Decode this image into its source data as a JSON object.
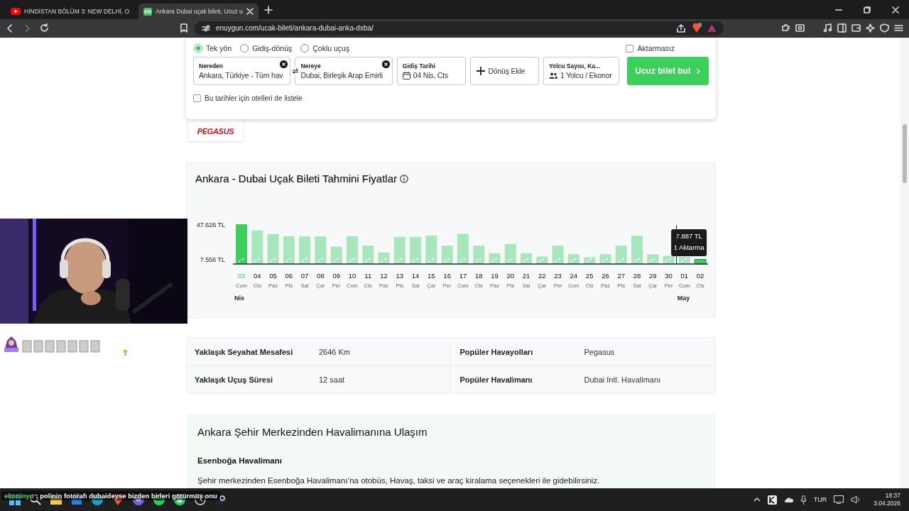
{
  "browser": {
    "tabs": [
      {
        "title": "HİNDİSTAN BÖLÜM 3: NEW DELHİ, O",
        "kind": "video",
        "selected": false
      },
      {
        "title": "Ankara Dubai uçak bileti, Ucuz u",
        "kind": "site",
        "favicon": "EN",
        "selected": true
      }
    ],
    "url": "enuygun.com/ucak-bileti/ankara-dubai-anka-dxba/"
  },
  "search_form": {
    "trip_types": [
      {
        "label": "Tek yön",
        "selected": true
      },
      {
        "label": "Gidiş-dönüş",
        "selected": false
      },
      {
        "label": "Çoklu uçuş",
        "selected": false
      }
    ],
    "nonstop": {
      "label": "Aktarmasız",
      "checked": false
    },
    "fields": [
      {
        "kind": "location",
        "label": "Nereden",
        "value": "Ankara, Türkiye - Tüm hav"
      },
      {
        "kind": "location",
        "label": "Nereye",
        "value": "Dubai, Birleşik Arap Emirli"
      },
      {
        "kind": "date",
        "label": "Gidiş Tarihi",
        "value": "04 Nis, Cts"
      },
      {
        "kind": "add",
        "value": "Dönüş Ekle"
      },
      {
        "kind": "passengers",
        "label": "Yolcu Sayısı, Ka...",
        "value": "1 Yolcu / Ekonor"
      }
    ],
    "search_button": "Ucuz bilet bul",
    "hotels": {
      "label": "Bu tarihler için otelleri de listele",
      "checked": false
    }
  },
  "airline_logo": "PEGASUS",
  "price_chart": {
    "title": "Ankara - Dubai Uçak Bileti Tahmini Fiyatlar",
    "chart_data": {
      "type": "bar",
      "categories": [
        "03",
        "04",
        "05",
        "06",
        "07",
        "08",
        "09",
        "10",
        "11",
        "12",
        "13",
        "14",
        "15",
        "16",
        "17",
        "18",
        "19",
        "20",
        "21",
        "22",
        "23",
        "24",
        "25",
        "26",
        "27",
        "28",
        "29",
        "30",
        "01",
        "02"
      ],
      "series": [
        {
          "color": "#a8e6bc",
          "values": [
            null,
            40700,
            36500,
            34100,
            33800,
            33800,
            22200,
            34100,
            23400,
            15600,
            33400,
            33400,
            34900,
            23400,
            36800,
            23400,
            14900,
            25300,
            14900,
            11000,
            23400,
            13700,
            10300,
            13700,
            23400,
            34500,
            13700,
            11800,
            10600,
            null
          ]
        },
        {
          "color": "#3ccf5c",
          "values": [
            47600,
            null,
            null,
            null,
            null,
            null,
            null,
            null,
            null,
            null,
            null,
            null,
            null,
            null,
            null,
            null,
            null,
            null,
            null,
            null,
            null,
            null,
            null,
            null,
            null,
            null,
            null,
            null,
            null,
            7887
          ]
        }
      ],
      "ylim": [
        2650,
        47626
      ],
      "yticks": [
        {
          "value": 47626,
          "label": "47.626 TL"
        },
        {
          "value": 7556,
          "label": "7.556 TL"
        }
      ]
    },
    "days": [
      {
        "weekday": "Cum",
        "selected": true,
        "hovered": false
      },
      {
        "weekday": "Cts",
        "selected": false,
        "hovered": false
      },
      {
        "weekday": "Paz",
        "selected": false,
        "hovered": false
      },
      {
        "weekday": "Pts",
        "selected": false,
        "hovered": false
      },
      {
        "weekday": "Sal",
        "selected": false,
        "hovered": false
      },
      {
        "weekday": "Çar",
        "selected": false,
        "hovered": false
      },
      {
        "weekday": "Per",
        "selected": false,
        "hovered": false
      },
      {
        "weekday": "Cum",
        "selected": false,
        "hovered": false
      },
      {
        "weekday": "Cts",
        "selected": false,
        "hovered": false
      },
      {
        "weekday": "Paz",
        "selected": false,
        "hovered": false
      },
      {
        "weekday": "Pts",
        "selected": false,
        "hovered": false
      },
      {
        "weekday": "Sal",
        "selected": false,
        "hovered": false
      },
      {
        "weekday": "Çar",
        "selected": false,
        "hovered": false
      },
      {
        "weekday": "Per",
        "selected": false,
        "hovered": false
      },
      {
        "weekday": "Cum",
        "selected": false,
        "hovered": false
      },
      {
        "weekday": "Cts",
        "selected": false,
        "hovered": false
      },
      {
        "weekday": "Paz",
        "selected": false,
        "hovered": false
      },
      {
        "weekday": "Pts",
        "selected": false,
        "hovered": false
      },
      {
        "weekday": "Sal",
        "selected": false,
        "hovered": false
      },
      {
        "weekday": "Çar",
        "selected": false,
        "hovered": false
      },
      {
        "weekday": "Per",
        "selected": false,
        "hovered": false
      },
      {
        "weekday": "Cum",
        "selected": false,
        "hovered": false
      },
      {
        "weekday": "Cts",
        "selected": false,
        "hovered": false
      },
      {
        "weekday": "Paz",
        "selected": false,
        "hovered": false
      },
      {
        "weekday": "Pts",
        "selected": false,
        "hovered": false
      },
      {
        "weekday": "Sal",
        "selected": false,
        "hovered": false
      },
      {
        "weekday": "Çar",
        "selected": false,
        "hovered": false
      },
      {
        "weekday": "Per",
        "selected": false,
        "hovered": false
      },
      {
        "weekday": "Cum",
        "selected": false,
        "hovered": false
      },
      {
        "weekday": "Cts",
        "selected": false,
        "hovered": true
      }
    ],
    "months": [
      {
        "label": "Nis",
        "month_start": false
      },
      {
        "label": "May",
        "month_start": true
      }
    ],
    "tooltip": {
      "price": "7.887 TL",
      "stops": "1 Aktarma"
    }
  },
  "info_table": {
    "rows": [
      [
        {
          "label": "Yaklaşık Seyahat Mesafesi",
          "value": "2646 Km"
        },
        {
          "label": "Popüler Havayolları",
          "value": "Pegasus"
        }
      ],
      [
        {
          "label": "Yaklaşık Uçuş Süresi",
          "value": "12 saat"
        },
        {
          "label": "Popüler Havalimanı",
          "value": "Dubai Intl. Havalimanı"
        }
      ]
    ]
  },
  "transport": {
    "title": "Ankara Şehir Merkezinden Havalimanına Ulaşım",
    "airport": "Esenboğa Havalimanı",
    "text": "Şehir merkezinden Esenboğa Havalimanı’na otobüs, Havaş, taksi ve araç kiralama seçenekleri ile gidebilirsiniz."
  },
  "stream_chat": {
    "user": "ekoninyo",
    "message": ": polinin fotorafı dubaideyse bizden birleri götürmüş onu"
  },
  "taskbar": {
    "language": "TUR",
    "time": "18:37",
    "date": "3.04.2026"
  }
}
